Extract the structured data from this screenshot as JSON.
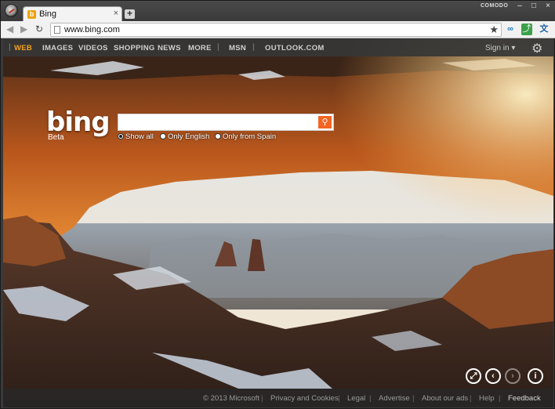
{
  "browser": {
    "tab_title": "Bing",
    "tab_close": "×",
    "new_tab": "+",
    "brand": "COMODO",
    "url": "www.bing.com",
    "window_controls": [
      "–",
      "□",
      "×"
    ]
  },
  "bing_nav": {
    "items": [
      "WEB",
      "IMAGES",
      "VIDEOS",
      "SHOPPING",
      "NEWS",
      "MORE",
      "MSN",
      "OUTLOOK.COM"
    ],
    "separators": [
      "|",
      "|",
      "|"
    ],
    "sign_in": "Sign in ▾"
  },
  "logo": {
    "text": "bing",
    "beta": "Beta"
  },
  "search": {
    "value": "",
    "options": [
      "Show all",
      "Only English",
      "Only from Spain"
    ],
    "selected": "Show all"
  },
  "footer": {
    "copyright": "© 2013 Microsoft",
    "links": [
      "Privacy and Cookies",
      "Legal",
      "Advertise",
      "About our ads",
      "Help"
    ],
    "feedback": "Feedback"
  },
  "icons": {
    "settings": "gear-icon",
    "fullscreen": "expand-icon",
    "prev": "chevron-left-icon",
    "next": "chevron-right-icon",
    "info": "info-icon"
  },
  "colors": {
    "accent": "#f7a11a",
    "search_button": "#f26522"
  }
}
